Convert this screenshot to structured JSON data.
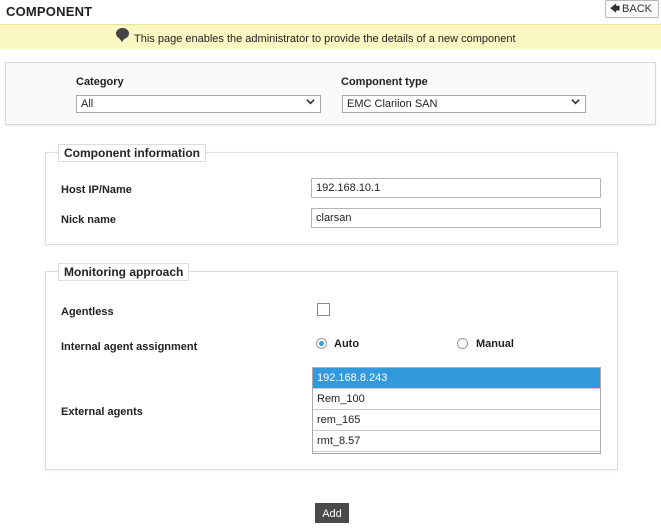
{
  "header": {
    "title": "COMPONENT",
    "back_label": "BACK"
  },
  "info_bar": {
    "message": "This page enables the administrator to provide the details of a new component"
  },
  "selectors": {
    "category": {
      "label": "Category",
      "value": "All"
    },
    "component_type": {
      "label": "Component type",
      "value": "EMC Clariion SAN"
    }
  },
  "component_information": {
    "legend": "Component information",
    "host": {
      "label": "Host IP/Name",
      "value": "192.168.10.1"
    },
    "nick": {
      "label": "Nick name",
      "value": "clarsan"
    }
  },
  "monitoring": {
    "legend": "Monitoring approach",
    "agentless": {
      "label": "Agentless",
      "checked": false
    },
    "internal_agent": {
      "label": "Internal agent assignment",
      "auto_label": "Auto",
      "manual_label": "Manual",
      "selected": "Auto"
    },
    "external_agents": {
      "label": "External agents",
      "items": [
        "192.168.8.243",
        "Rem_100",
        "rem_165",
        "rmt_8.57"
      ],
      "selected_index": 0
    }
  },
  "actions": {
    "add_label": "Add"
  },
  "colors": {
    "info_bar": "#fbf7c2",
    "selected_item": "#3399dd",
    "radio_accent": "#3a9fd8",
    "add_button": "#4a4a4a"
  }
}
